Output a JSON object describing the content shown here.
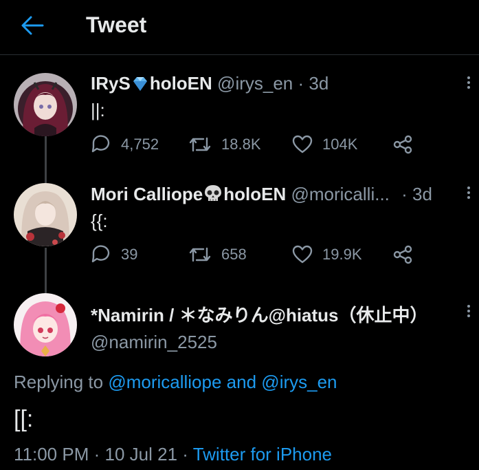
{
  "header": {
    "title": "Tweet"
  },
  "thread": [
    {
      "display_name": "IRyS",
      "name_suffix": "holoEN",
      "handle": "@irys_en",
      "time": "· 3d",
      "text": "||:",
      "replies": "4,752",
      "retweets": "18.8K",
      "likes": "104K"
    },
    {
      "display_name": "Mori Calliope",
      "name_suffix": "holoEN",
      "handle": "@moricalli...",
      "time": "· 3d",
      "text": "{{:",
      "replies": "39",
      "retweets": "658",
      "likes": "19.9K"
    }
  ],
  "main_tweet": {
    "display_name": "*Namirin / ＊なみりん@hiatus（休止中）",
    "handle": "@namirin_2525",
    "replying_prefix": "Replying to",
    "replying_user_1": "@moricalliope",
    "replying_and": "and",
    "replying_user_2": "@irys_en",
    "text": "[[:",
    "time": "11:00 PM",
    "date": "10 Jul 21",
    "separator": "·",
    "source": "Twitter for iPhone"
  },
  "icons": {
    "back": "arrow-left-icon",
    "reply": "comment-icon",
    "retweet": "retweet-icon",
    "like": "heart-icon",
    "share": "share-icon",
    "more": "more-vertical-icon",
    "badge_1": "gem-emoji",
    "badge_2": "skull-emoji"
  },
  "colors": {
    "background": "#000000",
    "accent": "#1d9bf0",
    "text_primary": "#e7e9ea",
    "text_secondary": "#8b98a5"
  }
}
